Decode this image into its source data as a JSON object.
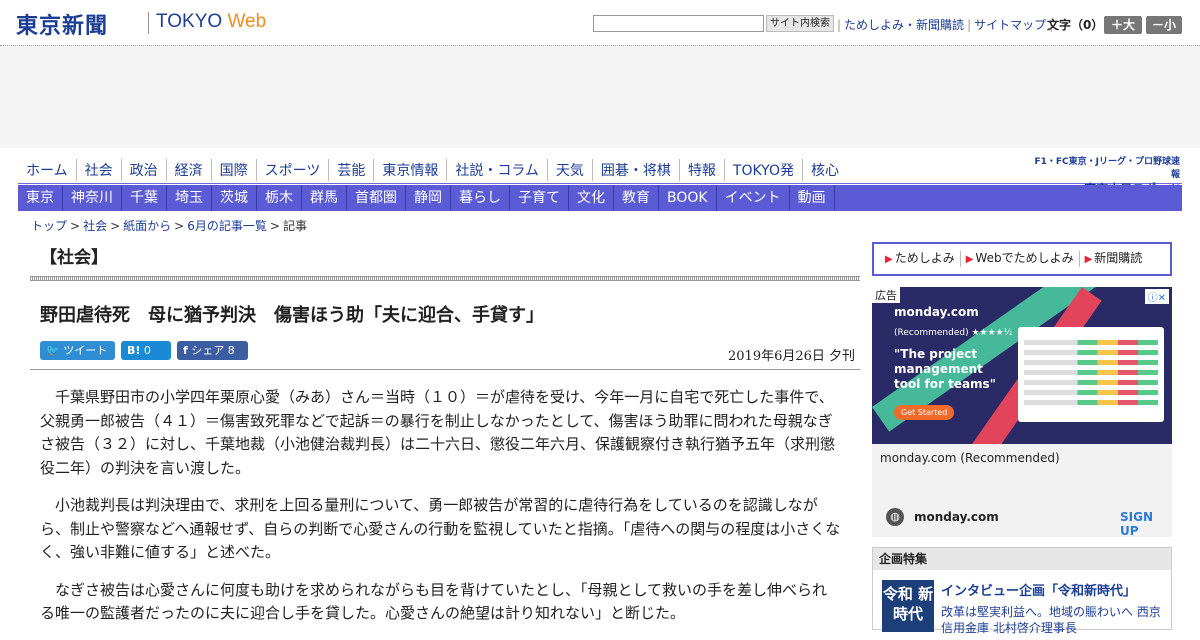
{
  "header": {
    "logo_jp": "東京新聞",
    "logo_en_a": "TOKYO",
    "logo_en_b": "Web",
    "search_button": "サイト内検索",
    "links": [
      "ためしよみ・新聞購読",
      "サイトマップ"
    ],
    "font_size_label": "文字（0）",
    "font_up": "＋大",
    "font_down": "－小"
  },
  "nav_primary": [
    "ホーム",
    "社会",
    "政治",
    "経済",
    "国際",
    "スポーツ",
    "芸能",
    "東京情報",
    "社説・コラム",
    "天気",
    "囲碁・将棋",
    "特報",
    "TOKYO発",
    "核心"
  ],
  "chunichi": {
    "line1": "F1・FC東京・Jリーグ・プロ野球速報",
    "line2": "東京中日スポーツ"
  },
  "nav_secondary": [
    "東京",
    "神奈川",
    "千葉",
    "埼玉",
    "茨城",
    "栃木",
    "群馬",
    "首都圏",
    "静岡",
    "暮らし",
    "子育て",
    "文化",
    "教育",
    "BOOK",
    "イベント",
    "動画"
  ],
  "breadcrumb": {
    "items": [
      "トップ",
      "社会",
      "紙面から",
      "6月の記事一覧"
    ],
    "current": "記事"
  },
  "section": "【社会】",
  "headline": "野田虐待死　母に猶予判決　傷害ほう助「夫に迎合、手貸す」",
  "share": {
    "tweet": "ツイート",
    "hatena": "B!",
    "hatena_count": "0",
    "facebook": "シェア",
    "facebook_count": "8"
  },
  "dateline": "2019年6月26日 夕刊",
  "article": [
    "千葉県野田市の小学四年栗原心愛（みあ）さん＝当時（１０）＝が虐待を受け、今年一月に自宅で死亡した事件で、父親勇一郎被告（４１）＝傷害致死罪などで起訴＝の暴行を制止しなかったとして、傷害ほう助罪に問われた母親なぎさ被告（３２）に対し、千葉地裁（小池健治裁判長）は二十六日、懲役二年六月、保護観察付き執行猶予五年（求刑懲役二年）の判決を言い渡した。",
    "小池裁判長は判決理由で、求刑を上回る量刑について、勇一郎被告が常習的に虐待行為をしているのを認識しながら、制止や警察などへ通報せず、自らの判断で心愛さんの行動を監視していたと指摘。「虐待への関与の程度は小さくなく、強い非難に値する」と述べた。",
    "なぎさ被告は心愛さんに何度も助けを求められながらも目を背けていたとし、「母親として救いの手を差し伸べられる唯一の監護者だったのに夫に迎合し手を貸した。心愛さんの絶望は計り知れない」と断じた。"
  ],
  "sidebar": {
    "tabs": [
      "ためしよみ",
      "Webでためしよみ",
      "新聞購読"
    ],
    "ad": {
      "label": "広告",
      "brand": "monday.com",
      "recommended": "(Recommended) ★★★★½",
      "headline": "\"The project management tool for teams\"",
      "cta": "Get Started",
      "title": "monday.com (Recommended)",
      "domain": "monday.com",
      "signup": "SIGN UP"
    },
    "feature": {
      "heading": "企画特集",
      "thumb": "令和 新時代",
      "title": "インタビュー企画「令和新時代」",
      "desc": "改革は堅実利益へ。地域の賑わいへ 西京信用金庫 北村啓介理事長"
    }
  },
  "colors": {
    "brand": "#1d3e96",
    "nav2_bg": "#5b5bd6",
    "accent_orange": "#f08c1c"
  }
}
